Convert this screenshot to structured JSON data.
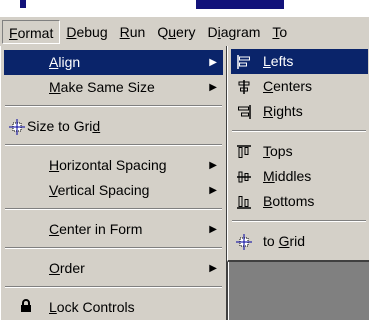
{
  "menubar": {
    "items": [
      {
        "label": "Format",
        "hotkey": "F",
        "active": true
      },
      {
        "label": "Debug",
        "hotkey": "D"
      },
      {
        "label": "Run",
        "hotkey": "R"
      },
      {
        "label": "Query",
        "hotkey": "u"
      },
      {
        "label": "Diagram",
        "hotkey": "i"
      },
      {
        "label": "To",
        "hotkey": "T"
      }
    ]
  },
  "format_menu": {
    "items": [
      {
        "label": "Align",
        "hotkey": "A",
        "has_submenu": true,
        "selected": true
      },
      {
        "label": "Make Same Size",
        "hotkey": "M",
        "has_submenu": true
      },
      {
        "label": "Size to Grid",
        "hotkey": "d",
        "icon": "size-to-grid-icon"
      },
      {
        "label": "Horizontal Spacing",
        "hotkey": "H",
        "has_submenu": true
      },
      {
        "label": "Vertical Spacing",
        "hotkey": "V",
        "has_submenu": true
      },
      {
        "label": "Center in Form",
        "hotkey": "C",
        "has_submenu": true
      },
      {
        "label": "Order",
        "hotkey": "O",
        "has_submenu": true
      },
      {
        "label": "Lock Controls",
        "hotkey": "L",
        "icon": "lock-icon"
      }
    ]
  },
  "align_submenu": {
    "items": [
      {
        "label": "Lefts",
        "hotkey": "L",
        "icon": "align-lefts-icon",
        "selected": true
      },
      {
        "label": "Centers",
        "hotkey": "C",
        "icon": "align-centers-icon"
      },
      {
        "label": "Rights",
        "hotkey": "R",
        "icon": "align-rights-icon"
      },
      {
        "label": "Tops",
        "hotkey": "T",
        "icon": "align-tops-icon"
      },
      {
        "label": "Middles",
        "hotkey": "M",
        "icon": "align-middles-icon"
      },
      {
        "label": "Bottoms",
        "hotkey": "B",
        "icon": "align-bottoms-icon"
      },
      {
        "label": "to Grid",
        "hotkey": "G",
        "icon": "align-to-grid-icon"
      }
    ]
  },
  "colors": {
    "menu_bg": "#d4d0c8",
    "highlight": "#0a246a",
    "highlight_text": "#ffffff"
  },
  "arrow_glyph": "▶"
}
